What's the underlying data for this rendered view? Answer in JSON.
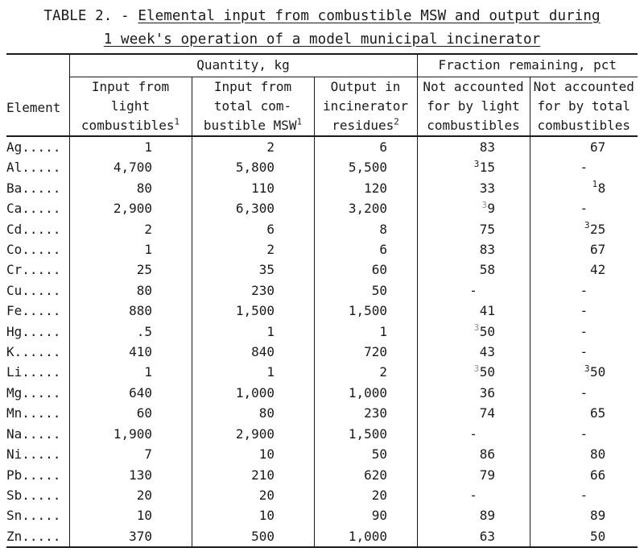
{
  "title": {
    "prefix": "TABLE 2. - ",
    "line1": "Elemental input from combustible MSW and output during",
    "line2": "1 week's operation of a model municipal incinerator"
  },
  "table": {
    "stub_header": "Element",
    "group_headers": [
      {
        "label": "Quantity, kg",
        "spans": 3
      },
      {
        "label": "Fraction remaining, pct",
        "spans": 2
      }
    ],
    "column_headers": [
      {
        "lines": [
          "Input from",
          "light",
          "combustibles"
        ],
        "superscript": "1"
      },
      {
        "lines": [
          "Input from",
          "total com-",
          "bustible MSW"
        ],
        "superscript": "1"
      },
      {
        "lines": [
          "Output in",
          "incinerator",
          "residues"
        ],
        "superscript": "2"
      },
      {
        "lines": [
          "Not accounted",
          "for by light",
          "combustibles"
        ],
        "superscript": ""
      },
      {
        "lines": [
          "Not accounted",
          "for by total",
          "combustibles"
        ],
        "superscript": ""
      }
    ],
    "rows": [
      {
        "element": "Ag",
        "leader": ".....",
        "cells": [
          {
            "value": "1"
          },
          {
            "value": "2"
          },
          {
            "value": "6"
          },
          {
            "value": "83"
          },
          {
            "value": "67"
          }
        ]
      },
      {
        "element": "Al",
        "leader": ".....",
        "cells": [
          {
            "value": "4,700"
          },
          {
            "value": "5,800"
          },
          {
            "value": "5,500"
          },
          {
            "value": "15",
            "pre_sup": "3"
          },
          {
            "value": "-",
            "dash": true
          }
        ]
      },
      {
        "element": "Ba",
        "leader": ".....",
        "cells": [
          {
            "value": "80"
          },
          {
            "value": "110"
          },
          {
            "value": "120"
          },
          {
            "value": "33"
          },
          {
            "value": "8",
            "pre_sup": "1"
          }
        ]
      },
      {
        "element": "Ca",
        "leader": ".....",
        "cells": [
          {
            "value": "2,900"
          },
          {
            "value": "6,300"
          },
          {
            "value": "3,200"
          },
          {
            "value": "9",
            "pre_sup": "3",
            "faint": true
          },
          {
            "value": "-",
            "dash": true
          }
        ]
      },
      {
        "element": "Cd",
        "leader": ".....",
        "cells": [
          {
            "value": "2"
          },
          {
            "value": "6"
          },
          {
            "value": "8"
          },
          {
            "value": "75"
          },
          {
            "value": "25",
            "pre_sup": "3"
          }
        ]
      },
      {
        "element": "Co",
        "leader": ".....",
        "cells": [
          {
            "value": "1"
          },
          {
            "value": "2"
          },
          {
            "value": "6"
          },
          {
            "value": "83"
          },
          {
            "value": "67"
          }
        ]
      },
      {
        "element": "Cr",
        "leader": ".....",
        "cells": [
          {
            "value": "25"
          },
          {
            "value": "35"
          },
          {
            "value": "60"
          },
          {
            "value": "58"
          },
          {
            "value": "42"
          }
        ]
      },
      {
        "element": "Cu",
        "leader": ".....",
        "cells": [
          {
            "value": "80"
          },
          {
            "value": "230"
          },
          {
            "value": "50"
          },
          {
            "value": "-",
            "dash": true
          },
          {
            "value": "-",
            "dash": true
          }
        ]
      },
      {
        "element": "Fe",
        "leader": ".....",
        "cells": [
          {
            "value": "880"
          },
          {
            "value": "1,500"
          },
          {
            "value": "1,500"
          },
          {
            "value": "41"
          },
          {
            "value": "-",
            "dash": true
          }
        ]
      },
      {
        "element": "Hg",
        "leader": ".....",
        "cells": [
          {
            "value": ".5"
          },
          {
            "value": "1"
          },
          {
            "value": "1"
          },
          {
            "value": "50",
            "pre_sup": "3",
            "faint": true
          },
          {
            "value": "-",
            "dash": true
          }
        ]
      },
      {
        "element": "K",
        "leader": "......",
        "cells": [
          {
            "value": "410"
          },
          {
            "value": "840"
          },
          {
            "value": "720"
          },
          {
            "value": "43"
          },
          {
            "value": "-",
            "dash": true
          }
        ]
      },
      {
        "element": "Li",
        "leader": ".....",
        "cells": [
          {
            "value": "1"
          },
          {
            "value": "1"
          },
          {
            "value": "2"
          },
          {
            "value": "50",
            "pre_sup": "3",
            "faint": true
          },
          {
            "value": "50",
            "pre_sup": "3"
          }
        ]
      },
      {
        "element": "Mg",
        "leader": ".....",
        "cells": [
          {
            "value": "640"
          },
          {
            "value": "1,000"
          },
          {
            "value": "1,000"
          },
          {
            "value": "36"
          },
          {
            "value": "-",
            "dash": true
          }
        ]
      },
      {
        "element": "Mn",
        "leader": ".....",
        "cells": [
          {
            "value": "60"
          },
          {
            "value": "80"
          },
          {
            "value": "230"
          },
          {
            "value": "74"
          },
          {
            "value": "65"
          }
        ]
      },
      {
        "element": "Na",
        "leader": ".....",
        "cells": [
          {
            "value": "1,900"
          },
          {
            "value": "2,900"
          },
          {
            "value": "1,500"
          },
          {
            "value": "-",
            "dash": true
          },
          {
            "value": "-",
            "dash": true
          }
        ]
      },
      {
        "element": "Ni",
        "leader": ".....",
        "cells": [
          {
            "value": "7"
          },
          {
            "value": "10"
          },
          {
            "value": "50"
          },
          {
            "value": "86"
          },
          {
            "value": "80"
          }
        ]
      },
      {
        "element": "Pb",
        "leader": ".....",
        "cells": [
          {
            "value": "130"
          },
          {
            "value": "210"
          },
          {
            "value": "620"
          },
          {
            "value": "79"
          },
          {
            "value": "66"
          }
        ]
      },
      {
        "element": "Sb",
        "leader": ".....",
        "cells": [
          {
            "value": "20"
          },
          {
            "value": "20"
          },
          {
            "value": "20"
          },
          {
            "value": "-",
            "dash": true
          },
          {
            "value": "-",
            "dash": true
          }
        ]
      },
      {
        "element": "Sn",
        "leader": ".....",
        "cells": [
          {
            "value": "10"
          },
          {
            "value": "10"
          },
          {
            "value": "90"
          },
          {
            "value": "89"
          },
          {
            "value": "89"
          }
        ]
      },
      {
        "element": "Zn",
        "leader": ".....",
        "cells": [
          {
            "value": "370"
          },
          {
            "value": "500"
          },
          {
            "value": "1,000"
          },
          {
            "value": "63"
          },
          {
            "value": "50"
          }
        ]
      }
    ]
  }
}
